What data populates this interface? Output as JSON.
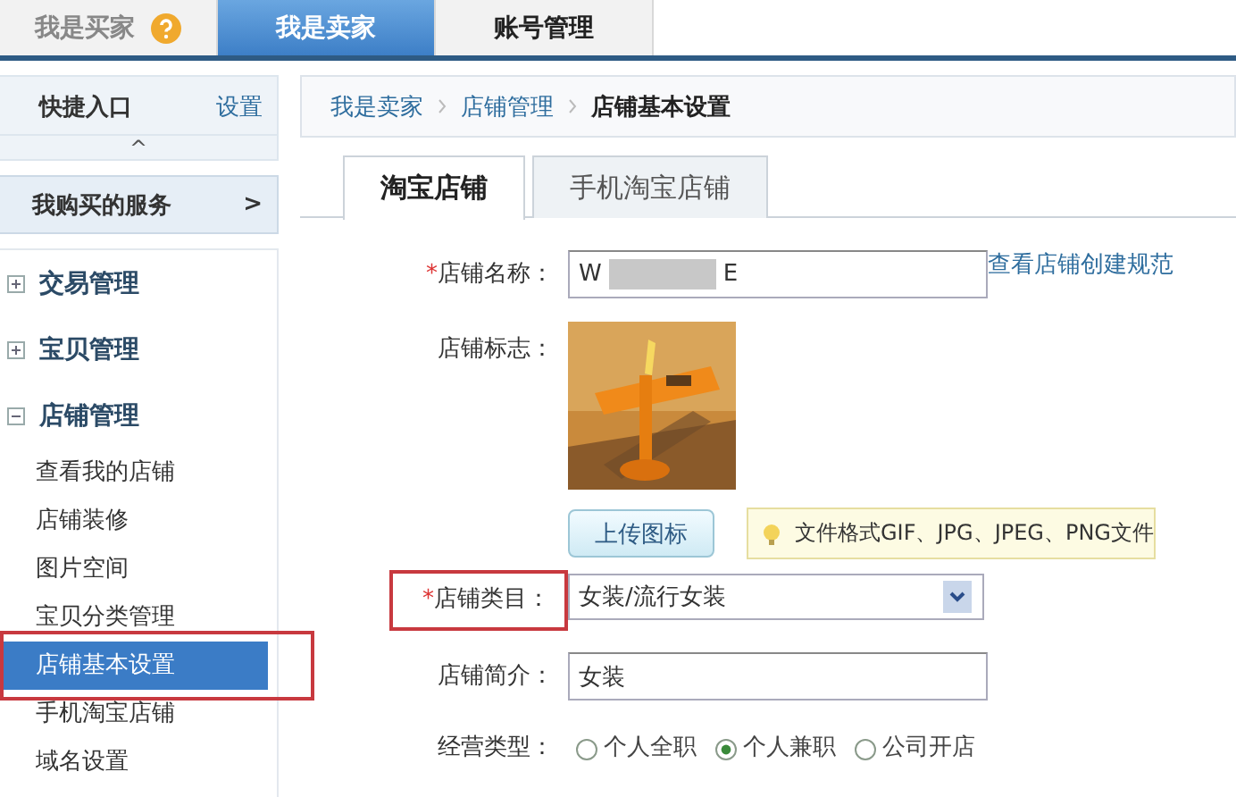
{
  "top_tabs": [
    {
      "label": "我是买家",
      "selected": false,
      "help": true
    },
    {
      "label": "我是卖家",
      "selected": true
    },
    {
      "label": "账号管理",
      "selected": false
    }
  ],
  "sidebar": {
    "quick_entry": {
      "title": "快捷入口",
      "action": "设置",
      "collapse": "^"
    },
    "services": {
      "label": "我购买的服务",
      "arrow": ">"
    },
    "sections": [
      {
        "label": "交易管理",
        "expanded": false
      },
      {
        "label": "宝贝管理",
        "expanded": false
      },
      {
        "label": "店铺管理",
        "expanded": true,
        "children": [
          {
            "label": "查看我的店铺",
            "selected": false,
            "highlighted": false
          },
          {
            "label": "店铺装修",
            "selected": false,
            "highlighted": false
          },
          {
            "label": "图片空间",
            "selected": false,
            "highlighted": false
          },
          {
            "label": "宝贝分类管理",
            "selected": false,
            "highlighted": false
          },
          {
            "label": "店铺基本设置",
            "selected": true,
            "highlighted": true
          },
          {
            "label": "手机淘宝店铺",
            "selected": false,
            "highlighted": false
          },
          {
            "label": "域名设置",
            "selected": false,
            "highlighted": false
          }
        ]
      }
    ]
  },
  "breadcrumb": [
    {
      "label": "我是卖家",
      "link": true
    },
    {
      "label": "店铺管理",
      "link": true
    },
    {
      "label": "店铺基本设置",
      "link": false
    }
  ],
  "tabs": [
    {
      "label": "淘宝店铺",
      "selected": true
    },
    {
      "label": "手机淘宝店铺",
      "selected": false
    }
  ],
  "form": [
    {
      "kind": "text",
      "label": "店铺名称：",
      "required_mark": "*",
      "highlighted": false,
      "value_parts": [
        "W",
        "E"
      ],
      "redacted": true,
      "link": "查看店铺创建规范"
    },
    {
      "kind": "logo",
      "label": "店铺标志：",
      "highlighted": false,
      "button": "上传图标",
      "tip": "文件格式GIF、JPG、JPEG、PNG文件"
    },
    {
      "kind": "select",
      "label": "店铺类目：",
      "required_mark": "*",
      "highlighted": true,
      "value": "女装/流行女装"
    },
    {
      "kind": "text",
      "label": "店铺简介：",
      "highlighted": false,
      "value_parts": [
        "女装"
      ]
    },
    {
      "kind": "radio",
      "label": "经营类型：",
      "highlighted": false,
      "options": [
        {
          "label": "个人全职",
          "selected": false
        },
        {
          "label": "个人兼职",
          "selected": true
        },
        {
          "label": "公司开店",
          "selected": false
        }
      ]
    }
  ]
}
